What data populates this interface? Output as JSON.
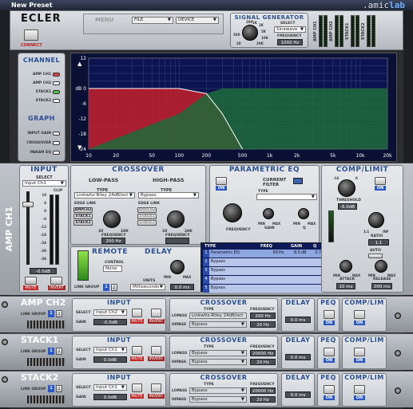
{
  "window": {
    "title": "New Preset"
  },
  "brand": {
    "prefix": ".amic",
    "suffix": "lab"
  },
  "logo": "ECLER",
  "connect": "CONNECT",
  "menus": {
    "menu": "MENU",
    "file": "FILE",
    "device": "DEVICE"
  },
  "signal_generator": {
    "title": "SIGNAL GENERATOR",
    "select_label": "SELECT",
    "select_value": "Sinewave",
    "freq_label": "FREQUENCY",
    "freq_value": "1000 Hz",
    "knob_ticks": [
      "200",
      "1K",
      "2K",
      "5K",
      "500",
      "10K",
      "20",
      "20K"
    ]
  },
  "vu": {
    "labels": [
      "AMP CH1",
      "AMP CH2",
      "STACK1",
      "STACK2"
    ]
  },
  "channel": {
    "title": "CHANNEL",
    "items": [
      "AMP CH1",
      "AMP CH2",
      "STACK1",
      "STACK2"
    ]
  },
  "graph": {
    "title": "GRAPH",
    "items": [
      "INPUT GAIN",
      "CROSSOVER",
      "PARAM EQ"
    ]
  },
  "plot": {
    "y_ticks": [
      "12",
      "dB 0",
      "-6",
      "-12",
      "-18",
      "-24"
    ],
    "x_ticks": [
      "10",
      "20",
      "50",
      "100",
      "200",
      "500",
      "1k",
      "2k",
      "5k",
      "10k",
      "20k"
    ]
  },
  "chart_data": {
    "type": "area",
    "xscale": "log",
    "xlim": [
      10,
      20000
    ],
    "ylim": [
      -24,
      12
    ],
    "x": [
      10,
      100,
      200,
      300,
      500
    ],
    "series": [
      {
        "values": [
          0,
          0,
          -2,
          -10,
          -24
        ]
      },
      {
        "values": [
          -24,
          -10,
          -2,
          0,
          0
        ]
      }
    ],
    "colors": [
      "#c61e2a",
      "#1f6b3a"
    ]
  },
  "strip_main": {
    "name": "AMP CH1"
  },
  "input": {
    "title": "INPUT",
    "select_label": "SELECT",
    "select_value": "Input Ch1",
    "clip": "CLIP",
    "gain": "-0.0dB",
    "mute": "MUTE",
    "invert": "INVERT",
    "scale": [
      "10",
      "6",
      "0",
      "-6",
      "-12",
      "-18",
      "-24",
      "-30",
      "-36"
    ]
  },
  "crossover": {
    "title": "CROSSOVER",
    "lowpass": "LOW-PASS",
    "highpass": "HIGH-PASS",
    "type_label": "TYPE",
    "lp_type": "Linkwitz-Riley 24dB/oct",
    "hp_type": "Bypass",
    "edge_link": "EDGE LINK",
    "links": [
      "AMPCH2",
      "STACK1",
      "STACK2"
    ],
    "freq_label": "FREQUENCY",
    "lp_freq": "200 Hz",
    "hp_freq": "",
    "ticks": [
      "20",
      "2K",
      "5K",
      "10K",
      "20K"
    ]
  },
  "peq": {
    "title": "PARAMETRIC EQ",
    "current_filter": "CURRENT FILTER",
    "type_label": "TYPE",
    "on": "ON",
    "freq_label": "FREQUENCY",
    "gain_label": "GAIN",
    "q_label": "Q",
    "min": "MIN",
    "max": "MAX",
    "table_headers": [
      "TYPE",
      "FREQ",
      "GAIN",
      "Q"
    ],
    "rows": [
      {
        "n": "1",
        "type": "Parametric EQ",
        "freq": "69",
        "unit": "Hz",
        "gain": "8.5",
        "gunit": "dB",
        "q": "3.7"
      },
      {
        "n": "2",
        "type": "Bypass",
        "freq": "",
        "unit": "",
        "gain": "",
        "gunit": "",
        "q": ""
      },
      {
        "n": "3",
        "type": "Bypass",
        "freq": "",
        "unit": "",
        "gain": "",
        "gunit": "",
        "q": ""
      },
      {
        "n": "4",
        "type": "Bypass",
        "freq": "",
        "unit": "",
        "gain": "",
        "gunit": "",
        "q": ""
      },
      {
        "n": "5",
        "type": "Bypass",
        "freq": "",
        "unit": "",
        "gain": "",
        "gunit": "",
        "q": ""
      }
    ]
  },
  "comp": {
    "title": "COMP/LIMIT",
    "on": "ON",
    "threshold_label": "THRESHOLD",
    "threshold_value": "-6.0dB",
    "ratio_label": "RATIO",
    "ratio_value": "1:1",
    "attack_label": "ATTACK",
    "attack_value": "10 ms",
    "release_label": "RELEASE",
    "release_value": "200 ms",
    "auto": "AUTO",
    "gr": "GAIN REDUCTION",
    "min": "MIN",
    "max": "MAX",
    "ticks": [
      "-16",
      "0",
      "1:1",
      "INF"
    ]
  },
  "remote": {
    "title": "REMOTE",
    "control_label": "CONTROL",
    "control_value": "None",
    "link_group": "LINK GROUP",
    "groups": [
      "1",
      "2"
    ]
  },
  "delay": {
    "title": "DELAY",
    "units_label": "UNITS",
    "units_value": "Milliseconds",
    "value": "0.0 ms",
    "min": "MIN",
    "max": "MAX"
  },
  "channels": [
    {
      "name": "AMP CH2",
      "input_title": "INPUT",
      "select_label": "SELECT",
      "select_value": "Input Ch2",
      "gain_label": "GAIN",
      "gain_value": "-0.0dB",
      "mute": "MUTE",
      "invert": "INVERT",
      "link_group": "LINK GROUP",
      "groups": [
        "1",
        "2"
      ],
      "xo_title": "CROSSOVER",
      "type_label": "TYPE",
      "freq_label": "FREQUENCY",
      "lopass": "LOPASS",
      "hipass": "HIPASS",
      "lp_type": "Linkwitz-Riley 24dB/oct",
      "lp_freq": "200 Hz",
      "hp_type": "Bypass",
      "hp_freq": "20 Hz",
      "delay_title": "DELAY",
      "delay_value": "0.0 ms",
      "peq_title": "PEQ",
      "comp_title": "COMP/LIM",
      "on": "ON"
    },
    {
      "name": "STACK1",
      "input_title": "INPUT",
      "select_label": "SELECT",
      "select_value": "Input Ch1",
      "gain_label": "GAIN",
      "gain_value": "0.0dB",
      "mute": "MUTE",
      "invert": "INVERT",
      "link_group": "LINK GROUP",
      "groups": [
        "1",
        "2"
      ],
      "xo_title": "CROSSOVER",
      "type_label": "TYPE",
      "freq_label": "FREQUENCY",
      "lopass": "LOPASS",
      "hipass": "HIPASS",
      "lp_type": "Bypass",
      "lp_freq": "20000 Hz",
      "hp_type": "Bypass",
      "hp_freq": "20 Hz",
      "delay_title": "DELAY",
      "delay_value": "0.0 ms",
      "peq_title": "PEQ",
      "comp_title": "COMP/LIM",
      "on": "ON"
    },
    {
      "name": "STACK2",
      "input_title": "INPUT",
      "select_label": "SELECT",
      "select_value": "Input Ch1",
      "gain_label": "GAIN",
      "gain_value": "0.0dB",
      "mute": "MUTE",
      "invert": "INVERT",
      "link_group": "LINK GROUP",
      "groups": [
        "1",
        "2"
      ],
      "xo_title": "CROSSOVER",
      "type_label": "TYPE",
      "freq_label": "FREQUENCY",
      "lopass": "LOPASS",
      "hipass": "HIPASS",
      "lp_type": "Bypass",
      "lp_freq": "20000 Hz",
      "hp_type": "Bypass",
      "hp_freq": "20 Hz",
      "delay_title": "DELAY",
      "delay_value": "0.0 ms",
      "peq_title": "PEQ",
      "comp_title": "COMP/LIM",
      "on": "ON"
    }
  ]
}
